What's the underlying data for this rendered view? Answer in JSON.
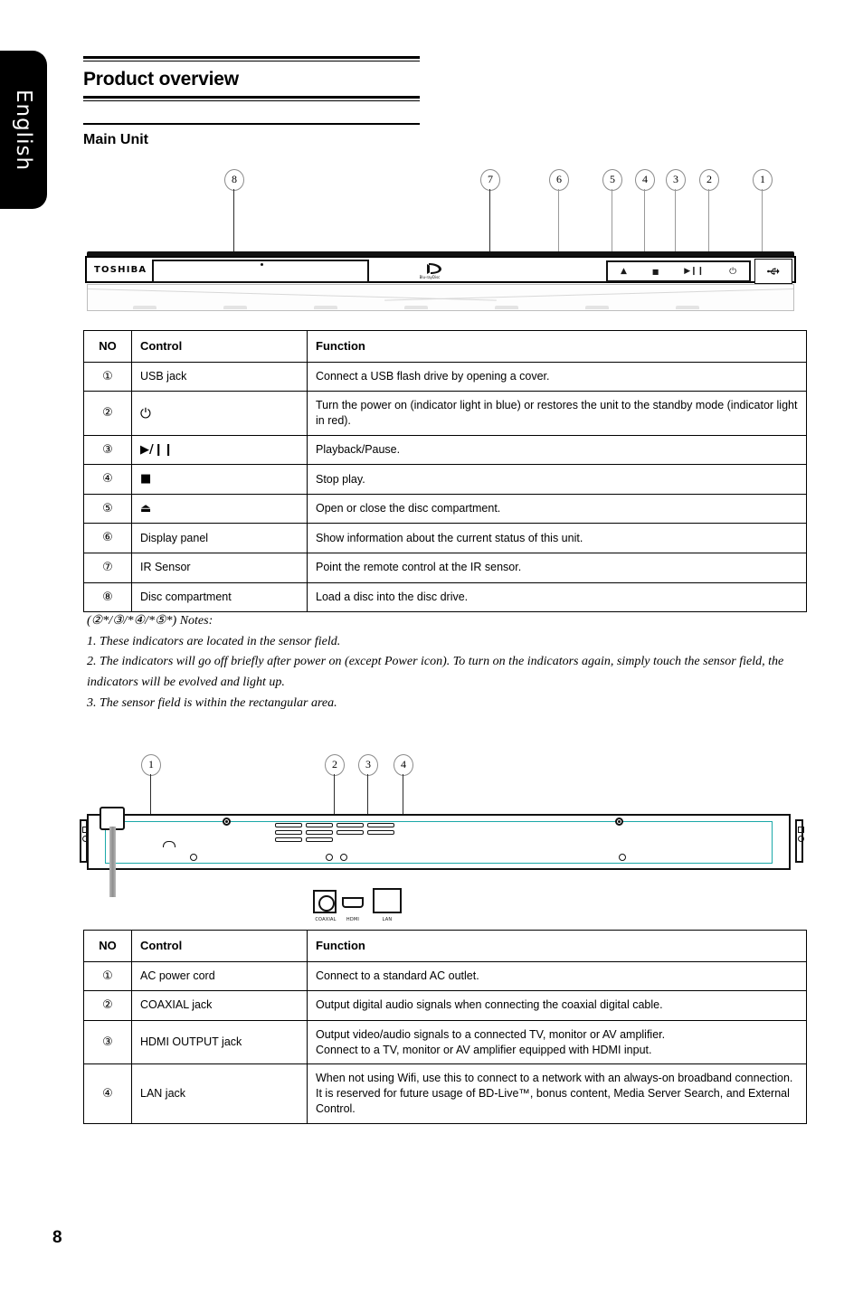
{
  "language_tab": {
    "label": "English"
  },
  "headings": {
    "page_title": "Product overview",
    "section_title": "Main Unit"
  },
  "front_panel_figure": {
    "brand": "TOSHIBA",
    "logo_alt": "Blu-ray Disc",
    "logo_text": "Blu-rayDisc",
    "callouts": [
      "8",
      "7",
      "6",
      "5",
      "4",
      "3",
      "2",
      "1"
    ],
    "control_icons": [
      "eject-icon",
      "stop-icon",
      "play-pause-icon",
      "power-icon"
    ],
    "control_glyphs": [
      "▲",
      "■",
      "▶❙❙",
      "⏻"
    ],
    "usb_icon_glyph": "☲"
  },
  "front_table": {
    "headers": [
      "NO",
      "Control",
      "Function"
    ],
    "rows": [
      {
        "no": "①",
        "control": "USB jack",
        "control_icon": "",
        "function": "Connect a USB flash drive by opening a cover."
      },
      {
        "no": "②",
        "control": "⏻",
        "control_icon": "power-icon",
        "function": "Turn the power on (indicator light in blue) or restores the unit to the standby mode (indicator light in red)."
      },
      {
        "no": "③",
        "control": "▶/❙❙",
        "control_icon": "play-pause-icon",
        "function": "Playback/Pause."
      },
      {
        "no": "④",
        "control": "■",
        "control_icon": "stop-icon",
        "function": "Stop play."
      },
      {
        "no": "⑤",
        "control": "⏏",
        "control_icon": "eject-icon",
        "function": "Open or close the disc compartment."
      },
      {
        "no": "⑥",
        "control": "Display panel",
        "control_icon": "",
        "function": "Show information about the current status of this unit."
      },
      {
        "no": "⑦",
        "control": "IR Sensor",
        "control_icon": "",
        "function": "Point the remote control at the IR sensor."
      },
      {
        "no": "⑧",
        "control": "Disc compartment",
        "control_icon": "",
        "function": "Load a disc into the disc drive."
      }
    ]
  },
  "notes": {
    "header": "(②*/③/*④/*⑤*) Notes:",
    "items": [
      "1. These indicators are located in the sensor field.",
      "2. The indicators will go off briefly after power on (except Power icon). To turn on the indicators again, simply touch the sensor field, the indicators will be evolved and light up.",
      "3. The sensor field is within the rectangular area."
    ]
  },
  "rear_panel_figure": {
    "callouts": [
      "1",
      "2",
      "3",
      "4"
    ],
    "port_labels": [
      "COAXIAL",
      "HDMI",
      "LAN"
    ],
    "accent_color": "#1aa8a8"
  },
  "rear_table": {
    "headers": [
      "NO",
      "Control",
      "Function"
    ],
    "rows": [
      {
        "no": "①",
        "control": "AC power cord",
        "function": "Connect to a standard AC outlet."
      },
      {
        "no": "②",
        "control": "COAXIAL jack",
        "function": "Output digital audio signals when connecting the coaxial digital cable."
      },
      {
        "no": "③",
        "control": "HDMI OUTPUT jack",
        "function": "Output video/audio signals to a connected TV, monitor or AV amplifier.\nConnect to a TV, monitor or AV amplifier equipped with HDMI input."
      },
      {
        "no": "④",
        "control": "LAN jack",
        "function": "When not using Wifi, use this to connect to a network with an always-on broadband connection. It is reserved for future usage of BD-Live™, bonus content, Media Server Search, and External Control."
      }
    ]
  },
  "footer": {
    "page_number": "8"
  }
}
